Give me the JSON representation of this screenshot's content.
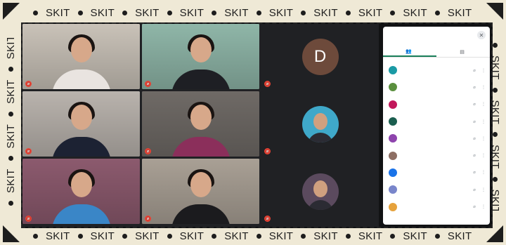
{
  "frame": {
    "word": "SKIT",
    "top_units": 10,
    "bottom_units": 10,
    "side_units": 4,
    "color": "#1d1d1d",
    "background": "#efe9d6"
  },
  "meeting": {
    "tiles": [
      {
        "id": "t1",
        "name": "",
        "kind": "video",
        "bg": "#c9c2b8",
        "shirt": "#e9e4e0"
      },
      {
        "id": "t2",
        "name": "",
        "kind": "video",
        "bg": "#8fb6a8",
        "shirt": "#1e1f24"
      },
      {
        "id": "t3",
        "name": "",
        "kind": "letter",
        "letter": "D",
        "avatar_color": "#6d4a3b",
        "bg": "#202124"
      },
      {
        "id": "t4",
        "name": "",
        "kind": "video",
        "bg": "#b9b3ad",
        "shirt": "#1c2233"
      },
      {
        "id": "t5",
        "name": "",
        "kind": "video",
        "bg": "#6f6a66",
        "shirt": "#8b2f5b"
      },
      {
        "id": "t6",
        "name": "",
        "kind": "photo",
        "avatar_color": "#3fa8c9",
        "bg": "#202124"
      },
      {
        "id": "t7",
        "name": "",
        "kind": "video",
        "bg": "#8c5a6e",
        "shirt": "#3a86c7"
      },
      {
        "id": "t8",
        "name": "",
        "kind": "video",
        "bg": "#a9a095",
        "shirt": "#1b1b1e"
      },
      {
        "id": "t9",
        "name": "",
        "kind": "photo",
        "avatar_color": "#5b4a5e",
        "bg": "#202124"
      }
    ]
  },
  "panel": {
    "title": "",
    "close_icon": "close-icon",
    "tabs": [
      {
        "label": "",
        "icon": "people-icon",
        "active": true
      },
      {
        "label": "",
        "icon": "chat-icon",
        "active": false
      }
    ],
    "participants": [
      {
        "initial": "",
        "color": "#1a9aa5",
        "name": ""
      },
      {
        "initial": "",
        "color": "#5a8f3e",
        "name": ""
      },
      {
        "initial": "",
        "color": "#c2185b",
        "name": ""
      },
      {
        "initial": "",
        "color": "#1b5e4f",
        "name": ""
      },
      {
        "initial": "",
        "color": "#8e44ad",
        "name": ""
      },
      {
        "initial": "",
        "color": "#8d6e63",
        "name": ""
      },
      {
        "initial": "",
        "color": "#1a73e8",
        "name": ""
      },
      {
        "initial": "",
        "color": "#7986cb",
        "name": ""
      },
      {
        "initial": "",
        "color": "#e6a23c",
        "name": ""
      }
    ]
  }
}
